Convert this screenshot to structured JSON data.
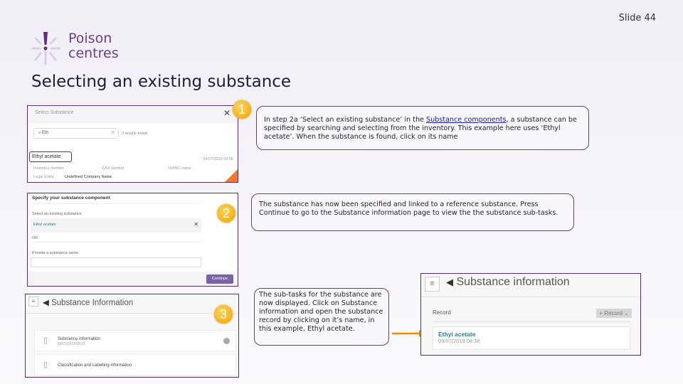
{
  "slide": {
    "number_label": "Slide 44",
    "title": "Selecting an existing substance"
  },
  "logo": {
    "line1": "Poison",
    "line2": "centres"
  },
  "badges": [
    "1",
    "2",
    "3"
  ],
  "panel1": {
    "header": "Select Substance",
    "search_value": "Eth",
    "results": "3 results found",
    "result_name": "Ethyl acetate",
    "result_date": "09/07/2019 08:06",
    "col1": "Inventory number",
    "col2": "CAS number",
    "col3": "IUPAC name",
    "legal_label": "Legal Entity",
    "legal_value": "Undefined Company Name"
  },
  "panel2": {
    "header": "Specify your substance component",
    "select_label": "Select an existing substance",
    "selected_value": "Ethyl acetate",
    "or_label": "OR",
    "name_label": "Provide a substance name",
    "name_value": "",
    "continue_label": "Continue"
  },
  "panel3": {
    "title": "Substance Information",
    "items": [
      {
        "label": "Substance information",
        "date": "09/07/2019 08:22"
      },
      {
        "label": "Classification and Labelling information",
        "date": ""
      }
    ]
  },
  "panel4": {
    "title": "Substance information",
    "section": "Record",
    "add_button": "Record",
    "record_name": "Ethyl acetate",
    "record_date": "09/07/2019 08:38"
  },
  "callouts": {
    "c1_pre": "In step 2a ‘Select an existing substance’ in the ",
    "c1_link": "Substance components",
    "c1_post": ", a substance can be specified by searching and selecting from the inventory. This example here uses ‘Ethyl acetate’. When the substance is found, click on its  name",
    "c2": "The substance has now been specified and linked to a reference substance. Press Continue to go to the Substance information page to view the the substance sub-tasks.",
    "c3": "The sub-tasks for the substance are now displayed. Click on Substance information and open the substance record by clicking on it’s name, in this example, Ethyl acetate."
  },
  "colors": {
    "accent": "#5a2d6e",
    "badge": "#f0a000",
    "arrow": "#f08a00",
    "link": "#2a7a9a"
  }
}
